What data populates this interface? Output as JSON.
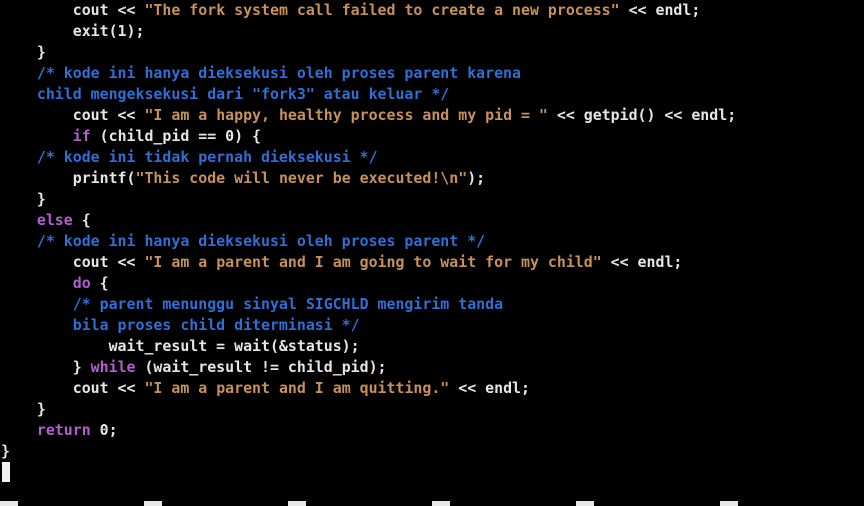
{
  "colors": {
    "background": "#000000",
    "plain": "#e6e6e6",
    "string": "#c8915a",
    "comment": "#2f6fd6",
    "keyword": "#b25fd0",
    "cursor": "#f2f2f2"
  },
  "code": {
    "lines": [
      {
        "indent": "        ",
        "tokens": [
          {
            "t": "plain",
            "v": "cout << "
          },
          {
            "t": "string",
            "v": "\"The fork system call failed to create a new process\""
          },
          {
            "t": "plain",
            "v": " << endl;"
          }
        ]
      },
      {
        "indent": "        ",
        "tokens": [
          {
            "t": "plain",
            "v": "exit(1);"
          }
        ]
      },
      {
        "indent": "    ",
        "tokens": [
          {
            "t": "plain",
            "v": "}"
          }
        ]
      },
      {
        "indent": "    ",
        "tokens": [
          {
            "t": "comment",
            "v": "/* kode ini hanya dieksekusi oleh proses parent karena"
          }
        ]
      },
      {
        "indent": "    ",
        "tokens": [
          {
            "t": "comment",
            "v": "child mengeksekusi dari \"fork3\" atau keluar */"
          }
        ]
      },
      {
        "indent": "        ",
        "tokens": [
          {
            "t": "plain",
            "v": "cout << "
          },
          {
            "t": "string",
            "v": "\"I am a happy, healthy process and my pid = \""
          },
          {
            "t": "plain",
            "v": " << getpid() << endl;"
          }
        ]
      },
      {
        "indent": "        ",
        "tokens": [
          {
            "t": "keyword",
            "v": "if"
          },
          {
            "t": "plain",
            "v": " (child_pid == 0) {"
          }
        ]
      },
      {
        "indent": "    ",
        "tokens": [
          {
            "t": "comment",
            "v": "/* kode ini tidak pernah dieksekusi */"
          }
        ]
      },
      {
        "indent": "        ",
        "tokens": [
          {
            "t": "plain",
            "v": "printf("
          },
          {
            "t": "string",
            "v": "\"This code will never be executed!\\n\""
          },
          {
            "t": "plain",
            "v": ");"
          }
        ]
      },
      {
        "indent": "    ",
        "tokens": [
          {
            "t": "plain",
            "v": "}"
          }
        ]
      },
      {
        "indent": "    ",
        "tokens": [
          {
            "t": "keyword",
            "v": "else"
          },
          {
            "t": "plain",
            "v": " {"
          }
        ]
      },
      {
        "indent": "    ",
        "tokens": [
          {
            "t": "comment",
            "v": "/* kode ini hanya dieksekusi oleh proses parent */"
          }
        ]
      },
      {
        "indent": "        ",
        "tokens": [
          {
            "t": "plain",
            "v": "cout << "
          },
          {
            "t": "string",
            "v": "\"I am a parent and I am going to wait for my child\""
          },
          {
            "t": "plain",
            "v": " << endl;"
          }
        ]
      },
      {
        "indent": "        ",
        "tokens": [
          {
            "t": "keyword",
            "v": "do"
          },
          {
            "t": "plain",
            "v": " {"
          }
        ]
      },
      {
        "indent": "        ",
        "tokens": [
          {
            "t": "comment",
            "v": "/* parent menunggu sinyal SIGCHLD mengirim tanda"
          }
        ]
      },
      {
        "indent": "        ",
        "tokens": [
          {
            "t": "comment",
            "v": "bila proses child diterminasi */"
          }
        ]
      },
      {
        "indent": "            ",
        "tokens": [
          {
            "t": "plain",
            "v": "wait_result = wait(&status);"
          }
        ]
      },
      {
        "indent": "        ",
        "tokens": [
          {
            "t": "plain",
            "v": "} "
          },
          {
            "t": "keyword",
            "v": "while"
          },
          {
            "t": "plain",
            "v": " (wait_result != child_pid);"
          }
        ]
      },
      {
        "indent": "        ",
        "tokens": [
          {
            "t": "plain",
            "v": "cout << "
          },
          {
            "t": "string",
            "v": "\"I am a parent and I am quitting.\""
          },
          {
            "t": "plain",
            "v": " << endl;"
          }
        ]
      },
      {
        "indent": "    ",
        "tokens": [
          {
            "t": "plain",
            "v": "}"
          }
        ]
      },
      {
        "indent": "    ",
        "tokens": [
          {
            "t": "keyword",
            "v": "return"
          },
          {
            "t": "plain",
            "v": " 0;"
          }
        ]
      },
      {
        "indent": "",
        "tokens": [
          {
            "t": "plain",
            "v": "}"
          }
        ]
      }
    ]
  }
}
